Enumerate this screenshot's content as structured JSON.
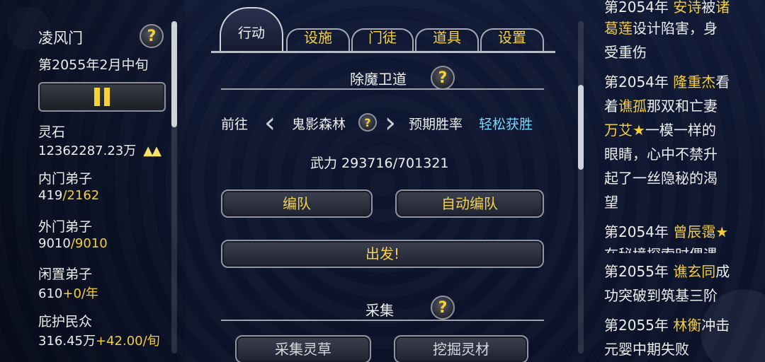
{
  "sect": {
    "name": "凌风门",
    "date": "第2055年2月中旬"
  },
  "stats": [
    {
      "label": "灵石",
      "value": "12362287.23万",
      "extra": "▲▲"
    },
    {
      "label": "内门弟子",
      "value": "419",
      "cap": "/2162"
    },
    {
      "label": "外门弟子",
      "value": "9010",
      "cap": "/9010"
    },
    {
      "label": "闲置弟子",
      "value": "610",
      "cap": "+0/年"
    },
    {
      "label": "庇护民众",
      "value": "316.45万",
      "cap": "+42.00/旬"
    }
  ],
  "tabs": {
    "active": "行动",
    "items": [
      "设施",
      "门徒",
      "道具",
      "设置"
    ]
  },
  "mission": {
    "title": "除魔卫道",
    "goto_label": "前往",
    "location": "鬼影森林",
    "rate_label": "预期胜率",
    "rate_value": "轻松获胜",
    "power": "武力 293716/701321",
    "form_label": "编队",
    "auto_form_label": "自动编队",
    "depart_label": "出发!"
  },
  "gather": {
    "title": "采集",
    "herbs_label": "采集灵草",
    "dig_label": "挖掘灵材"
  },
  "log": {
    "e1": {
      "l1a": "第2054年",
      "l1b": "安诗",
      "l1c": "被",
      "l1d": "诸",
      "l2a": "葛莲",
      "l2b": "设计陷害，身",
      "l3": "受重伤"
    },
    "e2": {
      "l1a": "第2054年",
      "l1b": "隆重杰",
      "l1c": "看",
      "l2a": "着",
      "l2b": "谯孤",
      "l2c": "那双和亡妻",
      "l3a": "万艾★",
      "l3b": "一模一样的",
      "l4": "眼睛，心中不禁升",
      "l5": "起了一丝隐秘的渴",
      "l6": "望"
    },
    "e3": {
      "l1a": "第2054年",
      "l1b": "曾辰霭★",
      "l2": "在秘境探索时偶遇"
    },
    "e4": {
      "l1a": "第2055年",
      "l1b": "谯玄同",
      "l1c": "成",
      "l2": "功突破到筑基三阶"
    },
    "e5": {
      "l1a": "第2055年",
      "l1b": "林衡",
      "l1c": "冲击",
      "l2": "元婴中期失败"
    }
  },
  "colors": {
    "gold": "#f4cd3c",
    "cyan": "#74d7ff",
    "background": "#0c1226"
  }
}
